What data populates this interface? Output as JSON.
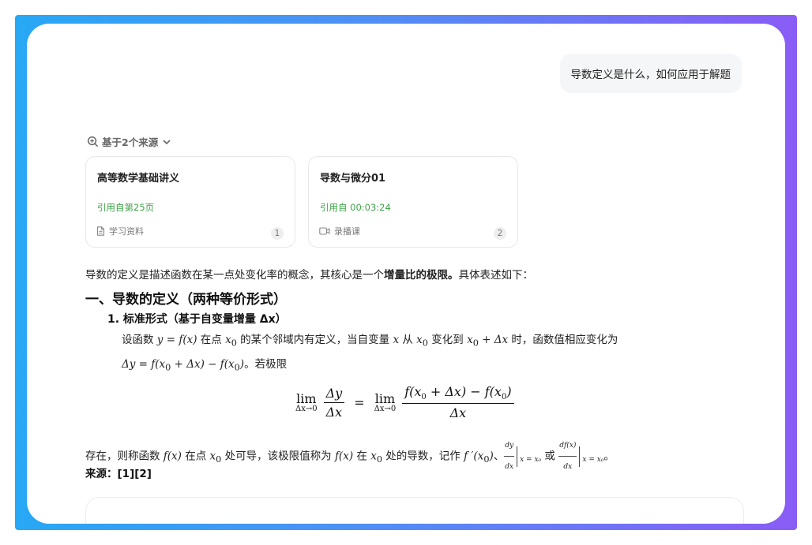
{
  "user_message": "导数定义是什么，如何应用于解题",
  "sources": {
    "toggle_label": "基于2个来源",
    "items": [
      {
        "title": "高等数学基础讲义",
        "cite": "引用自第25页",
        "type_label": "学习资料",
        "num": "1"
      },
      {
        "title": "导数与微分01",
        "cite": "引用自 00:03:24",
        "type_label": "录播课",
        "num": "2"
      }
    ]
  },
  "answer": {
    "intro_prefix": "导数的定义是描述函数在某一点处变化率的概念，其核心是一个",
    "intro_bold": "增量比的极限。",
    "intro_suffix": "具体表述如下：",
    "heading1": "一、导数的定义（两种等价形式）",
    "heading2": "1. 标准形式（基于自变量增量 Δx）",
    "para_t1": "设函数 ",
    "para_m1": "y = f(x)",
    "para_t2": " 在点 ",
    "para_m2": "x",
    "para_m2_sub": "0",
    "para_t3": " 的某个邻域内有定义，当自变量 ",
    "para_m3": "x",
    "para_t4": " 从 ",
    "para_m4": "x",
    "para_m4_sub": "0",
    "para_t5": " 变化到 ",
    "para_m5": "x",
    "para_m5_sub": "0",
    "para_m5_rest": " + Δx",
    "para_t6": " 时，函数值相应变化为",
    "para_m6": "Δy = f(x",
    "para_m6_sub": "0",
    "para_m6_mid": " + Δx) − f(x",
    "para_m6_sub2": "0",
    "para_m6_end": ")",
    "para_t7": "。若极限",
    "formula": {
      "lim": "lim",
      "lim_sub": "Δx→0",
      "frac1_num": "Δy",
      "frac1_den": "Δx",
      "eq": "=",
      "frac2_num_a": "f(x",
      "frac2_num_sub": "0",
      "frac2_num_b": " + Δx) − f(x",
      "frac2_num_sub2": "0",
      "frac2_num_c": ")",
      "frac2_den": "Δx"
    },
    "concl_t1": "存在，则称函数 ",
    "concl_m1": "f(x)",
    "concl_t2": " 在点 ",
    "concl_m2": "x",
    "concl_m2_sub": "0",
    "concl_t3": " 处可导，该极限值称为 ",
    "concl_m3": "f(x)",
    "concl_t4": " 在 ",
    "concl_m4": "x",
    "concl_m4_sub": "0",
    "concl_t5": " 处的导数，记作 ",
    "concl_m5": "f ′(x",
    "concl_m5_sub": "0",
    "concl_m5_end": ")",
    "concl_t6": "、",
    "d1_num": "dy",
    "d1_den": "dx",
    "d1_eval": "x = x₀",
    "concl_t7": " 或 ",
    "d2_num": "df(x)",
    "d2_den": "dx",
    "d2_eval": "x = x₀",
    "concl_t8": "。",
    "source_line": "来源：[1][2]"
  }
}
